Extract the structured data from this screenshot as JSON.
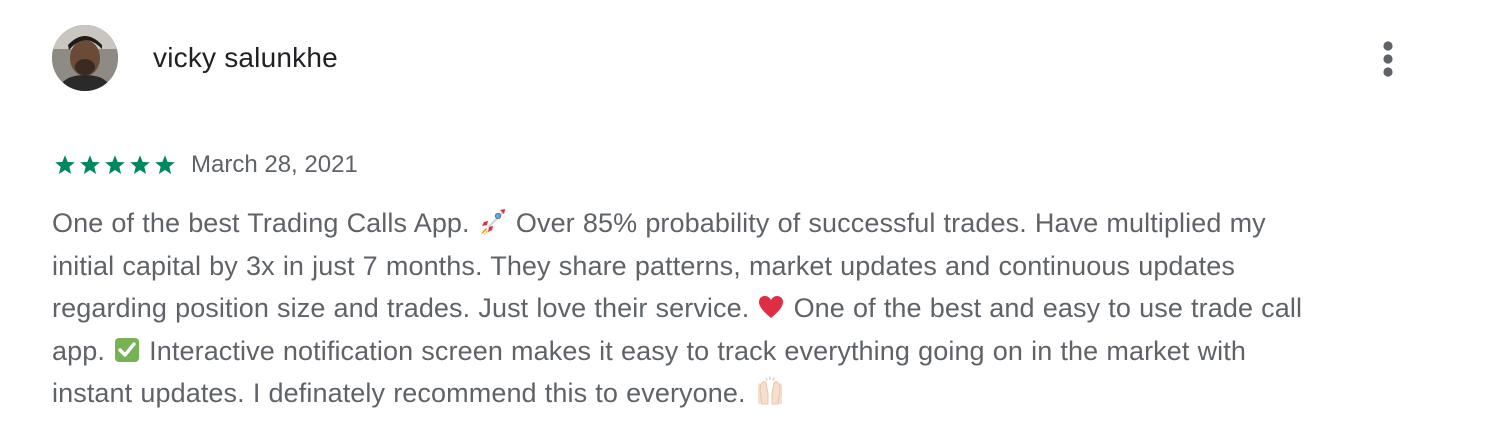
{
  "review": {
    "author": "vicky salunkhe",
    "rating": 5,
    "rating_max": 5,
    "date": "March 28, 2021",
    "accent_color": "#01875f",
    "text_lines": [
      [
        "One of the best Trading Calls App. ",
        "rocket-emoji",
        " Over 85% probability of successful trades. Have multiplied my"
      ],
      [
        "initial capital by 3x in just 7 months. They share patterns, market updates and continuous updates"
      ],
      [
        "regarding position size and trades. Just love their service. ",
        "red-heart-emoji",
        " One of the best and easy to use trade call"
      ],
      [
        "app. ",
        "check-mark-emoji",
        " Interactive notification screen makes it easy to track everything going on in the market with"
      ],
      [
        "instant updates. I definately recommend this to everyone. ",
        "raising-hands-emoji"
      ]
    ]
  },
  "icons": {
    "menu": "more-vertical-icon",
    "star": "star-icon"
  }
}
